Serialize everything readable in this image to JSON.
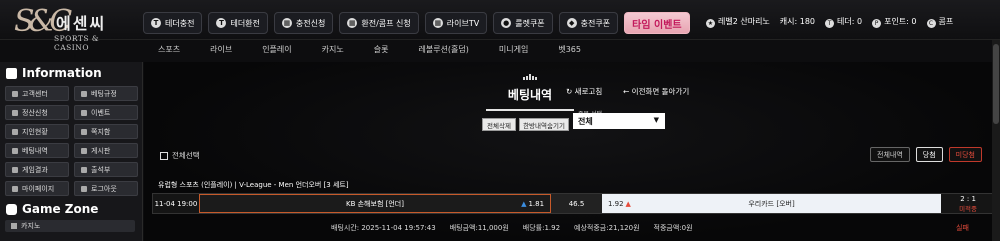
{
  "logo": {
    "mark": "S&C",
    "korean": "에센씨",
    "sub": "SPORTS & CASINO"
  },
  "topnav": [
    {
      "label": "테더충전",
      "icon": "T"
    },
    {
      "label": "테더환전",
      "icon": "T"
    },
    {
      "label": "충전신청",
      "icon": "▦"
    },
    {
      "label": "환전/콤프 신청",
      "icon": "▦"
    },
    {
      "label": "라이브TV",
      "icon": "▦"
    },
    {
      "label": "룰렛쿠폰",
      "icon": "●"
    },
    {
      "label": "충전쿠폰",
      "icon": "◆"
    }
  ],
  "event_label": "타임 이벤트",
  "user": {
    "level": "레벨2 산마리노",
    "cash": "캐시: 180",
    "tether": "테더: 0",
    "point": "포인트: 0",
    "comp": "콤프"
  },
  "subnav": [
    "스포츠",
    "라이브",
    "인플레이",
    "카지노",
    "슬롯",
    "레볼루션(홀덤)",
    "미니게임",
    "벳365"
  ],
  "sidebar": {
    "info_title": "Information",
    "items": [
      "고객센터",
      "베팅규정",
      "정산신청",
      "이벤트",
      "지인현황",
      "쪽지함",
      "베팅내역",
      "게시판",
      "게임결과",
      "출석부",
      "마이페이지",
      "로그아웃"
    ],
    "game_title": "Game Zone",
    "casino": "카지노"
  },
  "main": {
    "title": "베팅내역",
    "refresh": "새로고침",
    "back": "이전화면 돌아가기",
    "btn_delete_all": "전체삭제",
    "btn_hide": "한방내역숨기기",
    "select_label": "종목 선택",
    "select_value": "전체",
    "select_all": "전체선택",
    "filters": [
      "전체내역",
      "당첨",
      "미당첨"
    ]
  },
  "bet": {
    "header": "유럽형 스포츠 (인플레이) | V-League - Men  언더오버 [3 세트]",
    "time": "11-04 19:00",
    "home": "KB 손해보험 [언더]",
    "home_odd": "1.81",
    "draw": "46.5",
    "away_odd": "1.92",
    "away": "우리카드 [오버]",
    "score": "2 : 1",
    "status": "미적중",
    "bet_time": "배팅시간: 2025-11-04 19:57:43",
    "bet_amount": "배팅금액:11,000원",
    "bet_odds": "배당률:1.92",
    "expected": "예상적중금:21,120원",
    "won": "적중금액:0원",
    "result": "실패"
  }
}
